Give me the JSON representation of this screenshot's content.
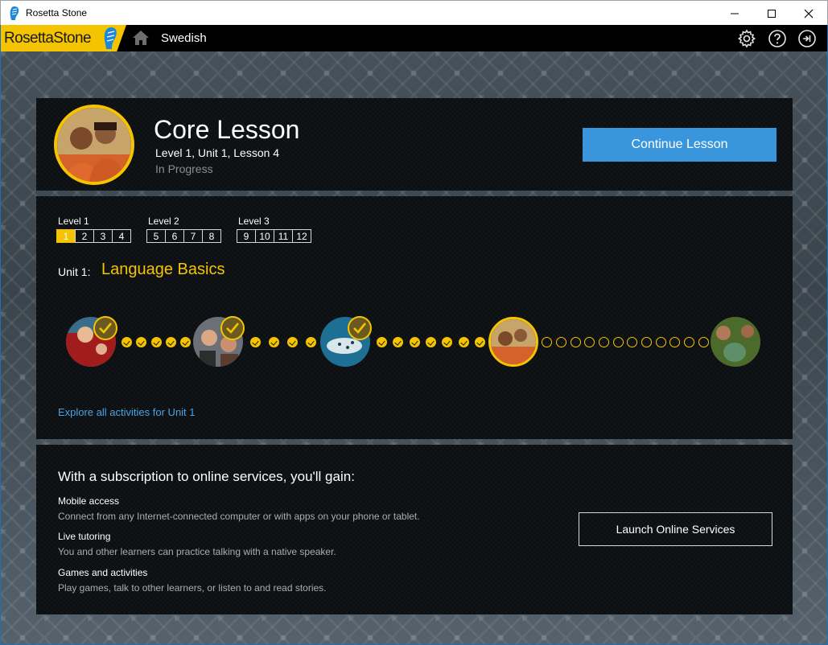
{
  "window": {
    "title": "Rosetta Stone",
    "app_icon": "rosetta-stone-icon"
  },
  "header": {
    "brand": "RosettaStone",
    "brand_first": "Rosetta",
    "brand_second": "Stone",
    "course": "Swedish",
    "icons": [
      "home-icon",
      "gear-icon",
      "help-icon",
      "sign-out-icon"
    ]
  },
  "lesson": {
    "title": "Core Lesson",
    "subtitle": "Level 1, Unit 1, Lesson 4",
    "status": "In Progress",
    "action_label": "Continue Lesson"
  },
  "levels": [
    {
      "label": "Level 1",
      "units": [
        "1",
        "2",
        "3",
        "4"
      ]
    },
    {
      "label": "Level 2",
      "units": [
        "5",
        "6",
        "7",
        "8"
      ]
    },
    {
      "label": "Level 3",
      "units": [
        "9",
        "10",
        "11",
        "12"
      ]
    }
  ],
  "selected_unit": "1",
  "unit": {
    "prefix": "Unit 1:",
    "name": "Language Basics"
  },
  "track": {
    "lessons": [
      {
        "completed": true,
        "current": false
      },
      {
        "completed": true,
        "current": false
      },
      {
        "completed": true,
        "current": false
      },
      {
        "completed": false,
        "current": true
      },
      {
        "completed": false,
        "current": false
      }
    ],
    "activity_segments": [
      {
        "done": 5,
        "total": 5
      },
      {
        "done": 4,
        "total": 4
      },
      {
        "done": 7,
        "total": 7
      },
      {
        "done": 0,
        "total": 12
      }
    ]
  },
  "explore_link": "Explore all activities for Unit 1",
  "subscription": {
    "heading": "With a subscription to online services, you'll gain:",
    "features": [
      {
        "title": "Mobile access",
        "desc": "Connect from any Internet-connected computer or with apps on your phone or tablet."
      },
      {
        "title": "Live tutoring",
        "desc": "You and other learners can practice talking with a native speaker."
      },
      {
        "title": "Games and activities",
        "desc": "Play games, talk to other learners, or listen to and read stories."
      }
    ],
    "action_label": "Launch Online Services"
  },
  "colors": {
    "accent": "#f5c400",
    "primary_button": "#3a96dc",
    "link": "#4aa3e6"
  }
}
